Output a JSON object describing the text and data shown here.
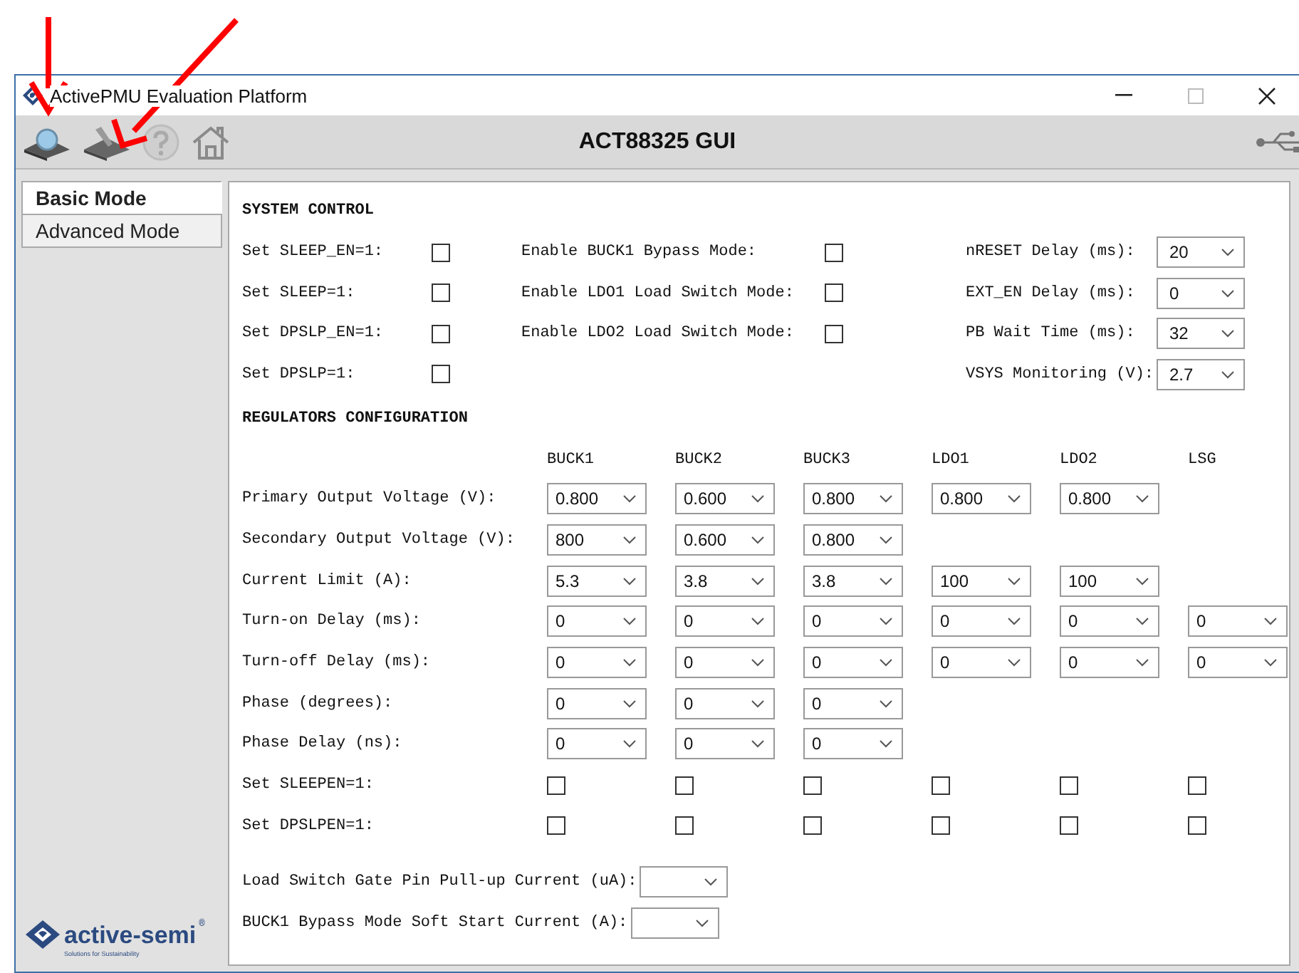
{
  "window": {
    "title": "ActivePMU Evaluation Platform"
  },
  "toolbar": {
    "title": "ACT88325 GUI"
  },
  "mode_tabs": [
    {
      "label": "Basic Mode",
      "selected": true
    },
    {
      "label": "Advanced Mode",
      "selected": false
    }
  ],
  "system_control": {
    "heading": "SYSTEM CONTROL",
    "checkbox_columns": [
      [
        {
          "label": "Set SLEEP_EN=1:",
          "checked": false
        },
        {
          "label": "Set SLEEP=1:",
          "checked": false
        },
        {
          "label": "Set DPSLP_EN=1:",
          "checked": false
        },
        {
          "label": "Set DPSLP=1:",
          "checked": false
        }
      ],
      [
        {
          "label": "Enable BUCK1 Bypass Mode:",
          "checked": false
        },
        {
          "label": "Enable LDO1 Load Switch Mode:",
          "checked": false
        },
        {
          "label": "Enable LDO2 Load Switch Mode:",
          "checked": false
        }
      ]
    ],
    "dropdowns": [
      {
        "label": "nRESET Delay (ms):",
        "value": "20"
      },
      {
        "label": "EXT_EN Delay (ms):",
        "value": "0"
      },
      {
        "label": "PB Wait Time (ms):",
        "value": "32"
      },
      {
        "label": "VSYS Monitoring (V):",
        "value": "2.7"
      }
    ]
  },
  "regulators": {
    "heading": "REGULATORS CONFIGURATION",
    "columns": [
      "BUCK1",
      "BUCK2",
      "BUCK3",
      "LDO1",
      "LDO2",
      "LSG"
    ],
    "rows": [
      {
        "label": "Primary Output Voltage (V):",
        "kind": "dropdown",
        "cells": [
          "0.800",
          "0.600",
          "0.800",
          "0.800",
          "0.800",
          null
        ]
      },
      {
        "label": "Secondary Output Voltage (V):",
        "kind": "dropdown",
        "cells": [
          "800",
          "0.600",
          "0.800",
          null,
          null,
          null
        ]
      },
      {
        "label": "Current Limit (A):",
        "kind": "dropdown",
        "cells": [
          "5.3",
          "3.8",
          "3.8",
          "100",
          "100",
          null
        ]
      },
      {
        "label": "Turn-on Delay (ms):",
        "kind": "dropdown",
        "cells": [
          "0",
          "0",
          "0",
          "0",
          "0",
          "0"
        ]
      },
      {
        "label": "Turn-off Delay (ms):",
        "kind": "dropdown",
        "cells": [
          "0",
          "0",
          "0",
          "0",
          "0",
          "0"
        ]
      },
      {
        "label": "Phase (degrees):",
        "kind": "dropdown",
        "cells": [
          "0",
          "0",
          "0",
          null,
          null,
          null
        ]
      },
      {
        "label": "Phase Delay (ns):",
        "kind": "dropdown",
        "cells": [
          "0",
          "0",
          "0",
          null,
          null,
          null
        ]
      },
      {
        "label": "Set SLEEPEN=1:",
        "kind": "checkbox",
        "cells": [
          {
            "checked": false
          },
          {
            "checked": false
          },
          {
            "checked": false
          },
          {
            "checked": false
          },
          {
            "checked": false
          },
          {
            "checked": false
          }
        ]
      },
      {
        "label": "Set DPSLPEN=1:",
        "kind": "checkbox",
        "cells": [
          {
            "checked": false
          },
          {
            "checked": false
          },
          {
            "checked": false
          },
          {
            "checked": false
          },
          {
            "checked": false
          },
          {
            "checked": false
          }
        ]
      }
    ]
  },
  "bottom_dropdowns": [
    {
      "label": "Load Switch Gate Pin Pull-up Current (uA):"
    },
    {
      "label": "BUCK1 Bypass Mode Soft Start Current (A):"
    }
  ],
  "logo": {
    "name": "active-semi",
    "mark": "®",
    "tagline": "Solutions for Sustainability"
  }
}
